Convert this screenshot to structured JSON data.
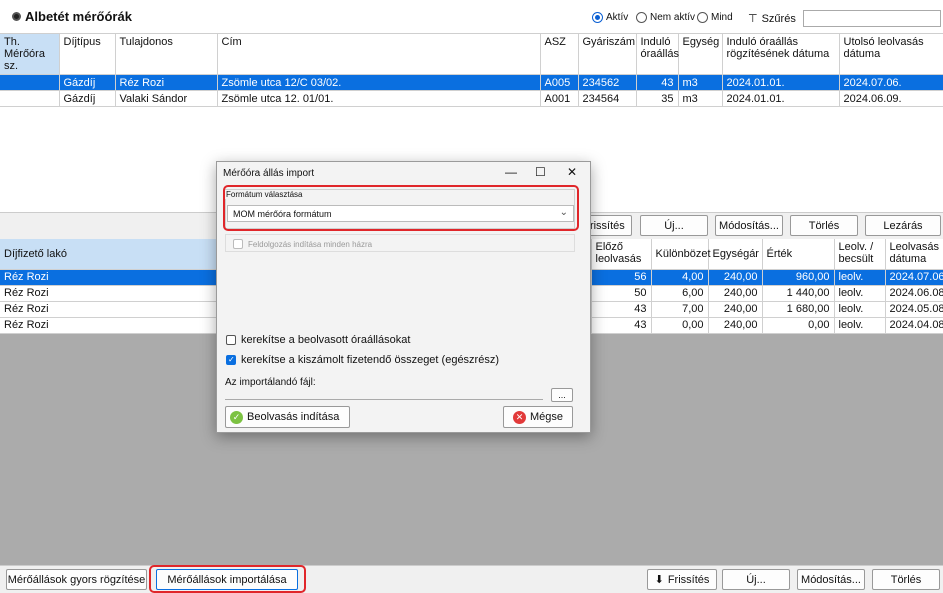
{
  "header": {
    "title": "Albetét mérőórák",
    "filters": [
      "Aktív",
      "Nem aktív",
      "Mind"
    ],
    "filter_label": "Szűrés"
  },
  "meters_table": {
    "columns": [
      "Th. Mérőóra sz.",
      "Díjtípus",
      "Tulajdonos",
      "Cím",
      "ASZ",
      "Gyáriszám",
      "Induló óraállás",
      "Egység",
      "Induló óraállás rögzítésének dátuma",
      "Utolsó leolvasás dátuma"
    ],
    "rows": [
      [
        "",
        "Gázdíj",
        "Réz Rozi",
        "Zsömle utca 12/C 03/02.",
        "A005",
        "234562",
        "43",
        "m3",
        "2024.01.01.",
        "2024.07.06."
      ],
      [
        "",
        "Gázdíj",
        "Valaki Sándor",
        "Zsömle utca 12. 01/01.",
        "A001",
        "234564",
        "35",
        "m3",
        "2024.01.01.",
        "2024.06.09."
      ]
    ]
  },
  "mid_buttons": {
    "refresh": "Frissítés",
    "new": "Új...",
    "edit": "Módosítás...",
    "delete": "Törlés",
    "close": "Lezárás"
  },
  "readings_table": {
    "columns": [
      "Díjfizető lakó",
      "Előző leolvasás",
      "Különbözet",
      "Egységár",
      "Érték",
      "Leolv. / becsült",
      "Leolvasás dátuma"
    ],
    "rows": [
      [
        "Réz Rozi",
        "56",
        "4,00",
        "240,00",
        "960,00",
        "leolv.",
        "2024.07.06."
      ],
      [
        "Réz Rozi",
        "50",
        "6,00",
        "240,00",
        "1 440,00",
        "leolv.",
        "2024.06.08."
      ],
      [
        "Réz Rozi",
        "43",
        "7,00",
        "240,00",
        "1 680,00",
        "leolv.",
        "2024.05.08."
      ],
      [
        "Réz Rozi",
        "43",
        "0,00",
        "240,00",
        "0,00",
        "leolv.",
        "2024.04.08."
      ]
    ]
  },
  "bottom_buttons": {
    "quick": "Mérőállások gyors rögzítése",
    "import": "Mérőállások importálása",
    "refresh": "Frissítés",
    "new": "Új...",
    "edit": "Módosítás...",
    "delete": "Törlés"
  },
  "dialog": {
    "title": "Mérőóra állás import",
    "format_legend": "Formátum választása",
    "format_value": "MOM mérőóra formátum",
    "all_houses": "Feldolgozás indítása minden házra",
    "round_readings": "kerekítse a beolvasott óraállásokat",
    "round_amount": "kerekítse a kiszámolt fizetendő összeget (egészrész)",
    "file_label": "Az importálandó fájl:",
    "browse": "...",
    "start": "Beolvasás indítása",
    "cancel": "Mégse"
  },
  "accent": "#0a6fe0",
  "highlight": "#e0262a"
}
